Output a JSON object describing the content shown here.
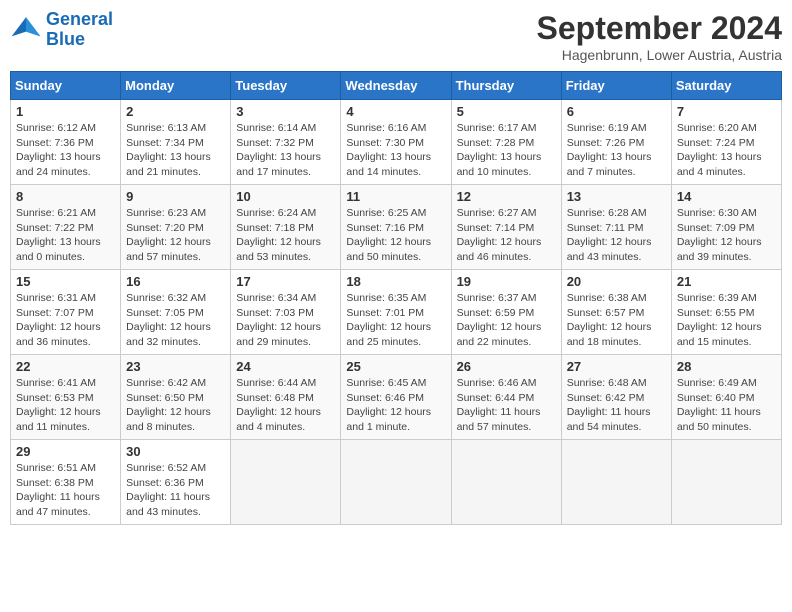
{
  "header": {
    "logo_line1": "General",
    "logo_line2": "Blue",
    "title": "September 2024",
    "subtitle": "Hagenbrunn, Lower Austria, Austria"
  },
  "calendar": {
    "columns": [
      "Sunday",
      "Monday",
      "Tuesday",
      "Wednesday",
      "Thursday",
      "Friday",
      "Saturday"
    ],
    "weeks": [
      [
        {
          "day": "1",
          "info": "Sunrise: 6:12 AM\nSunset: 7:36 PM\nDaylight: 13 hours\nand 24 minutes."
        },
        {
          "day": "2",
          "info": "Sunrise: 6:13 AM\nSunset: 7:34 PM\nDaylight: 13 hours\nand 21 minutes."
        },
        {
          "day": "3",
          "info": "Sunrise: 6:14 AM\nSunset: 7:32 PM\nDaylight: 13 hours\nand 17 minutes."
        },
        {
          "day": "4",
          "info": "Sunrise: 6:16 AM\nSunset: 7:30 PM\nDaylight: 13 hours\nand 14 minutes."
        },
        {
          "day": "5",
          "info": "Sunrise: 6:17 AM\nSunset: 7:28 PM\nDaylight: 13 hours\nand 10 minutes."
        },
        {
          "day": "6",
          "info": "Sunrise: 6:19 AM\nSunset: 7:26 PM\nDaylight: 13 hours\nand 7 minutes."
        },
        {
          "day": "7",
          "info": "Sunrise: 6:20 AM\nSunset: 7:24 PM\nDaylight: 13 hours\nand 4 minutes."
        }
      ],
      [
        {
          "day": "8",
          "info": "Sunrise: 6:21 AM\nSunset: 7:22 PM\nDaylight: 13 hours\nand 0 minutes."
        },
        {
          "day": "9",
          "info": "Sunrise: 6:23 AM\nSunset: 7:20 PM\nDaylight: 12 hours\nand 57 minutes."
        },
        {
          "day": "10",
          "info": "Sunrise: 6:24 AM\nSunset: 7:18 PM\nDaylight: 12 hours\nand 53 minutes."
        },
        {
          "day": "11",
          "info": "Sunrise: 6:25 AM\nSunset: 7:16 PM\nDaylight: 12 hours\nand 50 minutes."
        },
        {
          "day": "12",
          "info": "Sunrise: 6:27 AM\nSunset: 7:14 PM\nDaylight: 12 hours\nand 46 minutes."
        },
        {
          "day": "13",
          "info": "Sunrise: 6:28 AM\nSunset: 7:11 PM\nDaylight: 12 hours\nand 43 minutes."
        },
        {
          "day": "14",
          "info": "Sunrise: 6:30 AM\nSunset: 7:09 PM\nDaylight: 12 hours\nand 39 minutes."
        }
      ],
      [
        {
          "day": "15",
          "info": "Sunrise: 6:31 AM\nSunset: 7:07 PM\nDaylight: 12 hours\nand 36 minutes."
        },
        {
          "day": "16",
          "info": "Sunrise: 6:32 AM\nSunset: 7:05 PM\nDaylight: 12 hours\nand 32 minutes."
        },
        {
          "day": "17",
          "info": "Sunrise: 6:34 AM\nSunset: 7:03 PM\nDaylight: 12 hours\nand 29 minutes."
        },
        {
          "day": "18",
          "info": "Sunrise: 6:35 AM\nSunset: 7:01 PM\nDaylight: 12 hours\nand 25 minutes."
        },
        {
          "day": "19",
          "info": "Sunrise: 6:37 AM\nSunset: 6:59 PM\nDaylight: 12 hours\nand 22 minutes."
        },
        {
          "day": "20",
          "info": "Sunrise: 6:38 AM\nSunset: 6:57 PM\nDaylight: 12 hours\nand 18 minutes."
        },
        {
          "day": "21",
          "info": "Sunrise: 6:39 AM\nSunset: 6:55 PM\nDaylight: 12 hours\nand 15 minutes."
        }
      ],
      [
        {
          "day": "22",
          "info": "Sunrise: 6:41 AM\nSunset: 6:53 PM\nDaylight: 12 hours\nand 11 minutes."
        },
        {
          "day": "23",
          "info": "Sunrise: 6:42 AM\nSunset: 6:50 PM\nDaylight: 12 hours\nand 8 minutes."
        },
        {
          "day": "24",
          "info": "Sunrise: 6:44 AM\nSunset: 6:48 PM\nDaylight: 12 hours\nand 4 minutes."
        },
        {
          "day": "25",
          "info": "Sunrise: 6:45 AM\nSunset: 6:46 PM\nDaylight: 12 hours\nand 1 minute."
        },
        {
          "day": "26",
          "info": "Sunrise: 6:46 AM\nSunset: 6:44 PM\nDaylight: 11 hours\nand 57 minutes."
        },
        {
          "day": "27",
          "info": "Sunrise: 6:48 AM\nSunset: 6:42 PM\nDaylight: 11 hours\nand 54 minutes."
        },
        {
          "day": "28",
          "info": "Sunrise: 6:49 AM\nSunset: 6:40 PM\nDaylight: 11 hours\nand 50 minutes."
        }
      ],
      [
        {
          "day": "29",
          "info": "Sunrise: 6:51 AM\nSunset: 6:38 PM\nDaylight: 11 hours\nand 47 minutes."
        },
        {
          "day": "30",
          "info": "Sunrise: 6:52 AM\nSunset: 6:36 PM\nDaylight: 11 hours\nand 43 minutes."
        },
        {
          "day": "",
          "info": ""
        },
        {
          "day": "",
          "info": ""
        },
        {
          "day": "",
          "info": ""
        },
        {
          "day": "",
          "info": ""
        },
        {
          "day": "",
          "info": ""
        }
      ]
    ]
  }
}
